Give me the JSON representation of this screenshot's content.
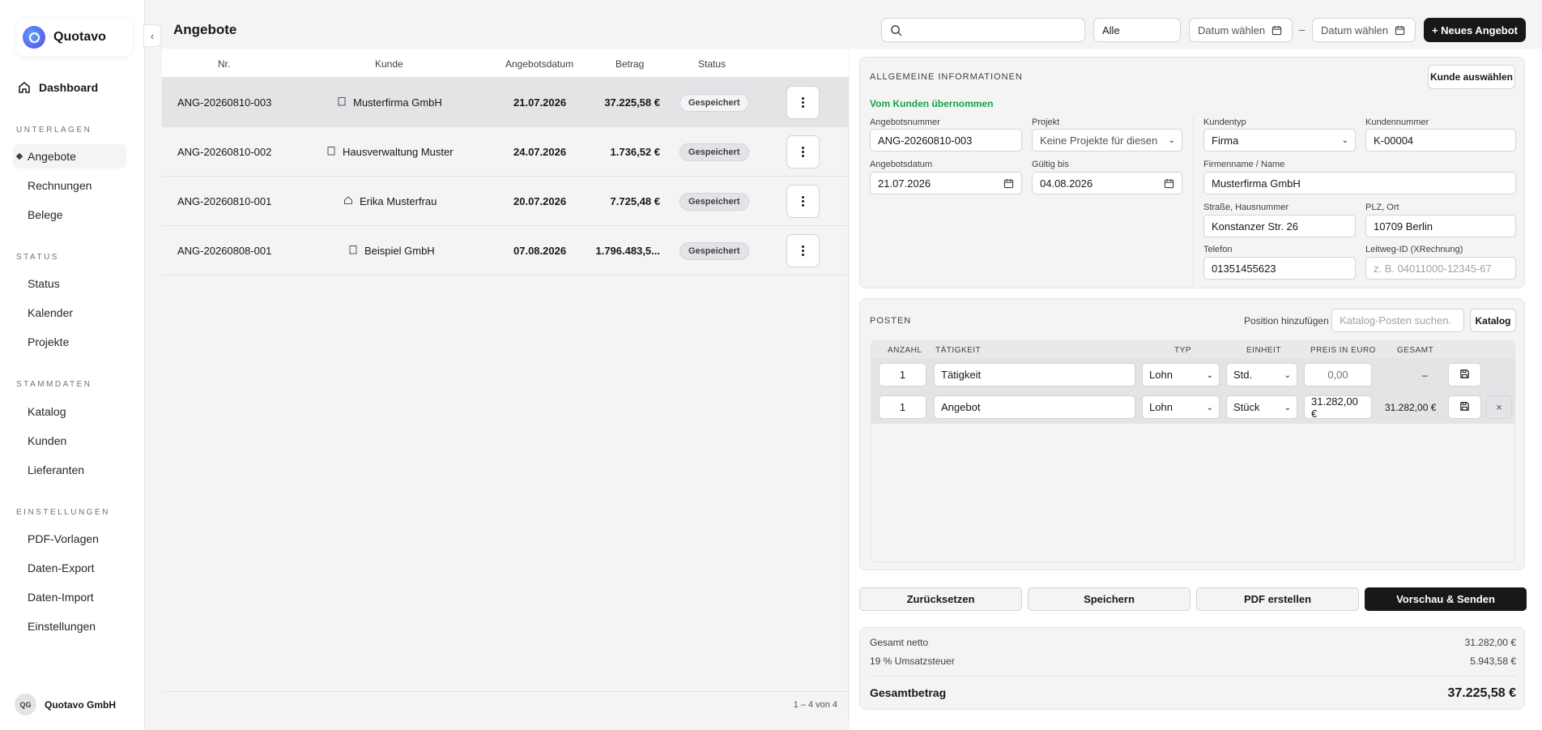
{
  "brand": {
    "name": "Quotavo"
  },
  "sidebar": {
    "dashboard": "Dashboard",
    "sections": [
      {
        "title": "UNTERLAGEN",
        "items": [
          "Angebote",
          "Rechnungen",
          "Belege"
        ]
      },
      {
        "title": "STATUS",
        "items": [
          "Status",
          "Kalender",
          "Projekte"
        ]
      },
      {
        "title": "STAMMDATEN",
        "items": [
          "Katalog",
          "Kunden",
          "Lieferanten"
        ]
      },
      {
        "title": "EINSTELLUNGEN",
        "items": [
          "PDF-Vorlagen",
          "Daten-Export",
          "Daten-Import",
          "Einstellungen"
        ]
      }
    ],
    "user": {
      "initials": "QG",
      "name": "Quotavo GmbH"
    }
  },
  "header": {
    "title": "Angebote",
    "filter": "Alle",
    "date_from": "Datum wählen",
    "date_sep": "–",
    "date_to": "Datum wählen",
    "new_button": "+ Neues Angebot"
  },
  "list": {
    "columns": [
      "Nr.",
      "Kunde",
      "Angebotsdatum",
      "Betrag",
      "Status"
    ],
    "rows": [
      {
        "nr": "ANG-20260810-003",
        "kunde": "Musterfirma GmbH",
        "datum": "21.07.2026",
        "betrag": "37.225,58 €",
        "status": "Gespeichert",
        "kind": "company"
      },
      {
        "nr": "ANG-20260810-002",
        "kunde": "Hausverwaltung Muster",
        "datum": "24.07.2026",
        "betrag": "1.736,52 €",
        "status": "Gespeichert",
        "kind": "company"
      },
      {
        "nr": "ANG-20260810-001",
        "kunde": "Erika Musterfrau",
        "datum": "20.07.2026",
        "betrag": "7.725,48 €",
        "status": "Gespeichert",
        "kind": "person"
      },
      {
        "nr": "ANG-20260808-001",
        "kunde": "Beispiel GmbH",
        "datum": "07.08.2026",
        "betrag": "1.796.483,5...",
        "status": "Gespeichert",
        "kind": "company"
      }
    ],
    "footer": "1 – 4 von 4"
  },
  "general": {
    "title": "ALLGEMEINE INFORMATIONEN",
    "select_customer": "Kunde auswählen",
    "from_customer": "Vom Kunden übernommen",
    "angebotsnummer_label": "Angebotsnummer",
    "angebotsnummer": "ANG-20260810-003",
    "projekt_label": "Projekt",
    "projekt": "Keine Projekte für diesen",
    "angebotsdatum_label": "Angebotsdatum",
    "angebotsdatum": "21.07.2026",
    "gueltig_label": "Gültig bis",
    "gueltig": "04.08.2026",
    "kundentyp_label": "Kundentyp",
    "kundentyp": "Firma",
    "kundennummer_label": "Kundennummer",
    "kundennummer": "K-00004",
    "firmenname_label": "Firmenname / Name",
    "firmenname": "Musterfirma GmbH",
    "strasse_label": "Straße, Hausnummer",
    "strasse": "Konstanzer Str. 26",
    "plz_label": "PLZ, Ort",
    "plz": "10709 Berlin",
    "telefon_label": "Telefon",
    "telefon": "01351455623",
    "leitweg_label": "Leitweg-ID (XRechnung)",
    "leitweg_placeholder": "z. B. 04011000-12345-67"
  },
  "posten": {
    "title": "POSTEN",
    "add_label": "Position hinzufügen",
    "catalog_placeholder": "Katalog-Posten suchen.",
    "catalog_button": "Katalog",
    "columns": [
      "ANZAHL",
      "TÄTIGKEIT",
      "TYP",
      "EINHEIT",
      "PREIS IN EURO",
      "GESAMT"
    ],
    "rows": [
      {
        "anzahl": "1",
        "taetigkeit": "Tätigkeit",
        "typ": "Lohn",
        "einheit": "Std.",
        "preis": "0,00",
        "gesamt": "–",
        "placeholder_price": true
      },
      {
        "anzahl": "1",
        "taetigkeit": "Angebot",
        "typ": "Lohn",
        "einheit": "Stück",
        "preis": "31.282,00 €",
        "gesamt": "31.282,00 €",
        "placeholder_price": false
      }
    ]
  },
  "actions": {
    "reset": "Zurücksetzen",
    "save": "Speichern",
    "pdf": "PDF erstellen",
    "send": "Vorschau & Senden"
  },
  "totals": {
    "netto_label": "Gesamt netto",
    "netto": "31.282,00 €",
    "ust_label": "19 % Umsatzsteuer",
    "ust": "5.943,58 €",
    "gesamt_label": "Gesamtbetrag",
    "gesamt": "37.225,58 €"
  },
  "colors": {
    "accent_green": "#16a34a",
    "primary_dark": "#18181b"
  }
}
